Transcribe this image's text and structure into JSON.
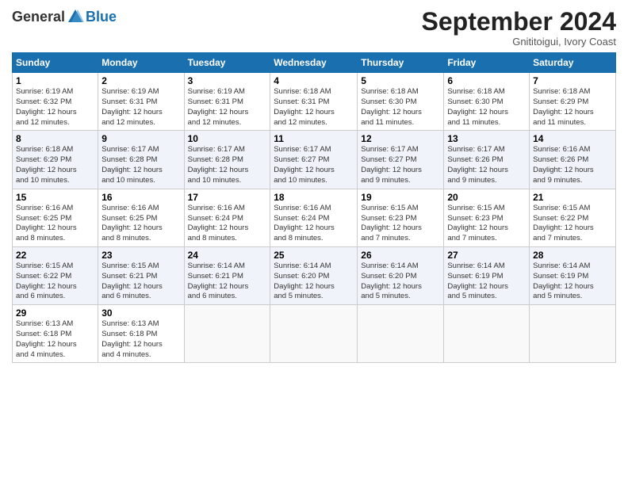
{
  "logo": {
    "general": "General",
    "blue": "Blue"
  },
  "title": "September 2024",
  "location": "Gnititoigui, Ivory Coast",
  "days_header": [
    "Sunday",
    "Monday",
    "Tuesday",
    "Wednesday",
    "Thursday",
    "Friday",
    "Saturday"
  ],
  "weeks": [
    [
      {
        "day": "1",
        "lines": [
          "Sunrise: 6:19 AM",
          "Sunset: 6:32 PM",
          "Daylight: 12 hours",
          "and 12 minutes."
        ]
      },
      {
        "day": "2",
        "lines": [
          "Sunrise: 6:19 AM",
          "Sunset: 6:31 PM",
          "Daylight: 12 hours",
          "and 12 minutes."
        ]
      },
      {
        "day": "3",
        "lines": [
          "Sunrise: 6:19 AM",
          "Sunset: 6:31 PM",
          "Daylight: 12 hours",
          "and 12 minutes."
        ]
      },
      {
        "day": "4",
        "lines": [
          "Sunrise: 6:18 AM",
          "Sunset: 6:31 PM",
          "Daylight: 12 hours",
          "and 12 minutes."
        ]
      },
      {
        "day": "5",
        "lines": [
          "Sunrise: 6:18 AM",
          "Sunset: 6:30 PM",
          "Daylight: 12 hours",
          "and 11 minutes."
        ]
      },
      {
        "day": "6",
        "lines": [
          "Sunrise: 6:18 AM",
          "Sunset: 6:30 PM",
          "Daylight: 12 hours",
          "and 11 minutes."
        ]
      },
      {
        "day": "7",
        "lines": [
          "Sunrise: 6:18 AM",
          "Sunset: 6:29 PM",
          "Daylight: 12 hours",
          "and 11 minutes."
        ]
      }
    ],
    [
      {
        "day": "8",
        "lines": [
          "Sunrise: 6:18 AM",
          "Sunset: 6:29 PM",
          "Daylight: 12 hours",
          "and 10 minutes."
        ]
      },
      {
        "day": "9",
        "lines": [
          "Sunrise: 6:17 AM",
          "Sunset: 6:28 PM",
          "Daylight: 12 hours",
          "and 10 minutes."
        ]
      },
      {
        "day": "10",
        "lines": [
          "Sunrise: 6:17 AM",
          "Sunset: 6:28 PM",
          "Daylight: 12 hours",
          "and 10 minutes."
        ]
      },
      {
        "day": "11",
        "lines": [
          "Sunrise: 6:17 AM",
          "Sunset: 6:27 PM",
          "Daylight: 12 hours",
          "and 10 minutes."
        ]
      },
      {
        "day": "12",
        "lines": [
          "Sunrise: 6:17 AM",
          "Sunset: 6:27 PM",
          "Daylight: 12 hours",
          "and 9 minutes."
        ]
      },
      {
        "day": "13",
        "lines": [
          "Sunrise: 6:17 AM",
          "Sunset: 6:26 PM",
          "Daylight: 12 hours",
          "and 9 minutes."
        ]
      },
      {
        "day": "14",
        "lines": [
          "Sunrise: 6:16 AM",
          "Sunset: 6:26 PM",
          "Daylight: 12 hours",
          "and 9 minutes."
        ]
      }
    ],
    [
      {
        "day": "15",
        "lines": [
          "Sunrise: 6:16 AM",
          "Sunset: 6:25 PM",
          "Daylight: 12 hours",
          "and 8 minutes."
        ]
      },
      {
        "day": "16",
        "lines": [
          "Sunrise: 6:16 AM",
          "Sunset: 6:25 PM",
          "Daylight: 12 hours",
          "and 8 minutes."
        ]
      },
      {
        "day": "17",
        "lines": [
          "Sunrise: 6:16 AM",
          "Sunset: 6:24 PM",
          "Daylight: 12 hours",
          "and 8 minutes."
        ]
      },
      {
        "day": "18",
        "lines": [
          "Sunrise: 6:16 AM",
          "Sunset: 6:24 PM",
          "Daylight: 12 hours",
          "and 8 minutes."
        ]
      },
      {
        "day": "19",
        "lines": [
          "Sunrise: 6:15 AM",
          "Sunset: 6:23 PM",
          "Daylight: 12 hours",
          "and 7 minutes."
        ]
      },
      {
        "day": "20",
        "lines": [
          "Sunrise: 6:15 AM",
          "Sunset: 6:23 PM",
          "Daylight: 12 hours",
          "and 7 minutes."
        ]
      },
      {
        "day": "21",
        "lines": [
          "Sunrise: 6:15 AM",
          "Sunset: 6:22 PM",
          "Daylight: 12 hours",
          "and 7 minutes."
        ]
      }
    ],
    [
      {
        "day": "22",
        "lines": [
          "Sunrise: 6:15 AM",
          "Sunset: 6:22 PM",
          "Daylight: 12 hours",
          "and 6 minutes."
        ]
      },
      {
        "day": "23",
        "lines": [
          "Sunrise: 6:15 AM",
          "Sunset: 6:21 PM",
          "Daylight: 12 hours",
          "and 6 minutes."
        ]
      },
      {
        "day": "24",
        "lines": [
          "Sunrise: 6:14 AM",
          "Sunset: 6:21 PM",
          "Daylight: 12 hours",
          "and 6 minutes."
        ]
      },
      {
        "day": "25",
        "lines": [
          "Sunrise: 6:14 AM",
          "Sunset: 6:20 PM",
          "Daylight: 12 hours",
          "and 5 minutes."
        ]
      },
      {
        "day": "26",
        "lines": [
          "Sunrise: 6:14 AM",
          "Sunset: 6:20 PM",
          "Daylight: 12 hours",
          "and 5 minutes."
        ]
      },
      {
        "day": "27",
        "lines": [
          "Sunrise: 6:14 AM",
          "Sunset: 6:19 PM",
          "Daylight: 12 hours",
          "and 5 minutes."
        ]
      },
      {
        "day": "28",
        "lines": [
          "Sunrise: 6:14 AM",
          "Sunset: 6:19 PM",
          "Daylight: 12 hours",
          "and 5 minutes."
        ]
      }
    ],
    [
      {
        "day": "29",
        "lines": [
          "Sunrise: 6:13 AM",
          "Sunset: 6:18 PM",
          "Daylight: 12 hours",
          "and 4 minutes."
        ]
      },
      {
        "day": "30",
        "lines": [
          "Sunrise: 6:13 AM",
          "Sunset: 6:18 PM",
          "Daylight: 12 hours",
          "and 4 minutes."
        ]
      },
      {
        "day": "",
        "lines": []
      },
      {
        "day": "",
        "lines": []
      },
      {
        "day": "",
        "lines": []
      },
      {
        "day": "",
        "lines": []
      },
      {
        "day": "",
        "lines": []
      }
    ]
  ]
}
